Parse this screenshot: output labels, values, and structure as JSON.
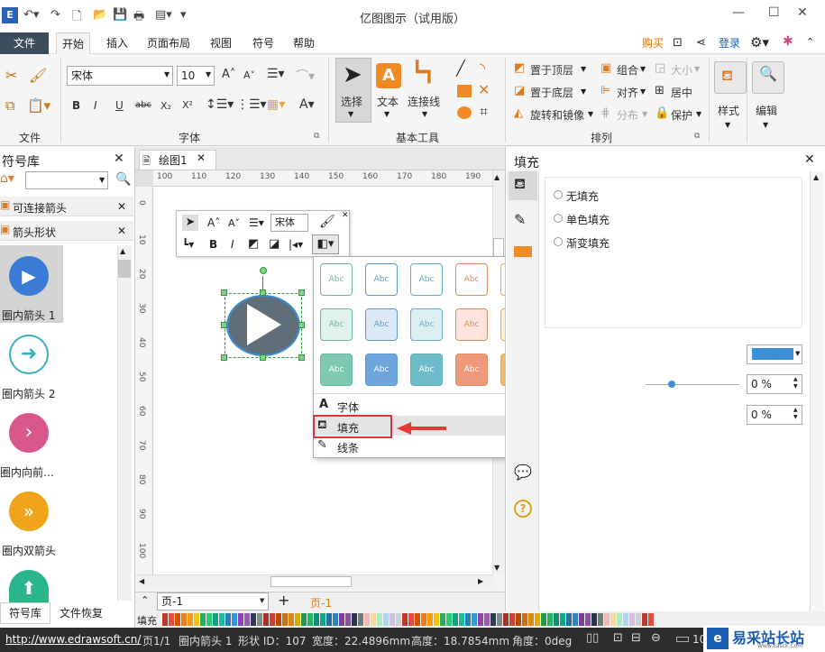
{
  "app": {
    "title": "亿图图示（试用版）"
  },
  "menubar": {
    "file_label": "文件",
    "tabs": [
      "开始",
      "插入",
      "页面布局",
      "视图",
      "符号",
      "帮助"
    ],
    "right": {
      "buy": "购买",
      "login": "登录"
    }
  },
  "ribbon": {
    "groups": {
      "file": "文件",
      "font": "字体",
      "tools": "基本工具",
      "arrange": "排列"
    },
    "font_name": "宋体",
    "font_size": "10",
    "tools": {
      "select": "选择",
      "text": "文本",
      "connector": "连接线"
    },
    "arrange": {
      "to_top": "置于顶层",
      "to_bottom": "置于底层",
      "rotate": "旋转和镜像",
      "group": "组合",
      "align": "对齐",
      "distribute": "分布",
      "size": "大小",
      "center": "居中",
      "protect": "保护"
    },
    "style": "样式",
    "edit": "编辑"
  },
  "symbol_lib": {
    "title": "符号库",
    "categories": [
      "可连接箭头",
      "箭头形状"
    ],
    "items": [
      "圈内箭头 1",
      "圈内箭头 2",
      "圈内向前…",
      "圈内双箭头"
    ],
    "bottom_tabs": [
      "符号库",
      "文件恢复"
    ]
  },
  "doc_tab": "绘图1",
  "ruler_top": [
    "100",
    "110",
    "120",
    "130",
    "140",
    "150",
    "160",
    "170",
    "180",
    "190"
  ],
  "ruler_left": [
    "0",
    "10",
    "20",
    "30",
    "40",
    "50",
    "60",
    "70",
    "80",
    "90",
    "100"
  ],
  "float_toolbar": {
    "font": "宋体"
  },
  "swatch_label": "Abc",
  "dropdown_menu": {
    "font": "字体",
    "fill": "填充",
    "line": "线条"
  },
  "fill_panel": {
    "title": "填充",
    "options": [
      "无填充",
      "单色填充",
      "渐变填充"
    ],
    "pct1": "0 %",
    "pct2": "0 %"
  },
  "page_tabs": {
    "current": "页-1",
    "active": "页-1"
  },
  "fill_bar_label": "填充",
  "statusbar": {
    "url": "http://www.edrawsoft.cn/",
    "page": "页1/1",
    "shape": "圈内箭头 1",
    "shape_id": "形状 ID：107",
    "width": "宽度：22.4896mm",
    "height": "高度：18.7854mm",
    "angle": "角度：0deg",
    "zoom_tail": "10"
  },
  "watermark": {
    "text": "易采站长站",
    "sub": "Www.Easck.Com"
  },
  "colors": {
    "accent": "#3c8fd6",
    "arrow_red": "#e53935",
    "shape_fill": "#5f6e78"
  }
}
